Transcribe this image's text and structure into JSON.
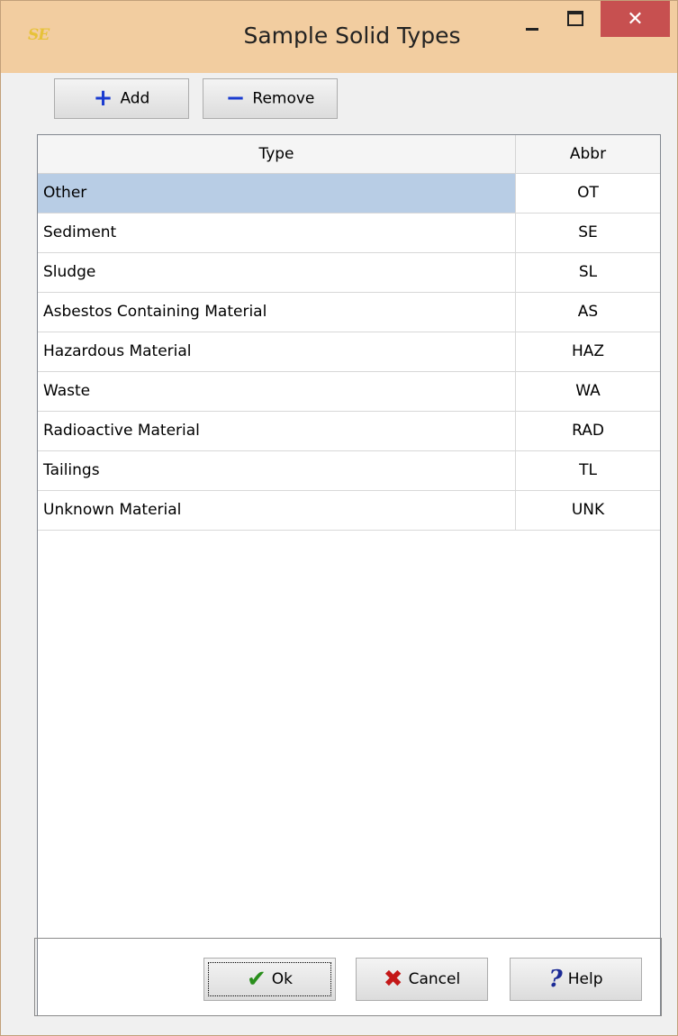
{
  "window": {
    "title": "Sample Solid Types",
    "app_icon_text": "SE",
    "close_glyph": "✕"
  },
  "toolbar": {
    "add_label": "Add",
    "add_icon": "+",
    "remove_label": "Remove",
    "remove_icon": "−"
  },
  "table": {
    "columns": [
      "Type",
      "Abbr"
    ],
    "selected_row": 0,
    "rows": [
      {
        "type": "Other",
        "abbr": "OT"
      },
      {
        "type": "Sediment",
        "abbr": "SE"
      },
      {
        "type": "Sludge",
        "abbr": "SL"
      },
      {
        "type": "Asbestos Containing Material",
        "abbr": "AS"
      },
      {
        "type": "Hazardous Material",
        "abbr": "HAZ"
      },
      {
        "type": "Waste",
        "abbr": "WA"
      },
      {
        "type": "Radioactive Material",
        "abbr": "RAD"
      },
      {
        "type": "Tailings",
        "abbr": "TL"
      },
      {
        "type": "Unknown Material",
        "abbr": "UNK"
      }
    ]
  },
  "buttons": {
    "ok_label": "Ok",
    "ok_icon": "✔",
    "cancel_label": "Cancel",
    "cancel_icon": "✖",
    "help_label": "Help",
    "help_icon": "?"
  },
  "colors": {
    "titlebar": "#f2cda0",
    "close_button": "#c75050",
    "selected_row": "#b8cde5"
  }
}
